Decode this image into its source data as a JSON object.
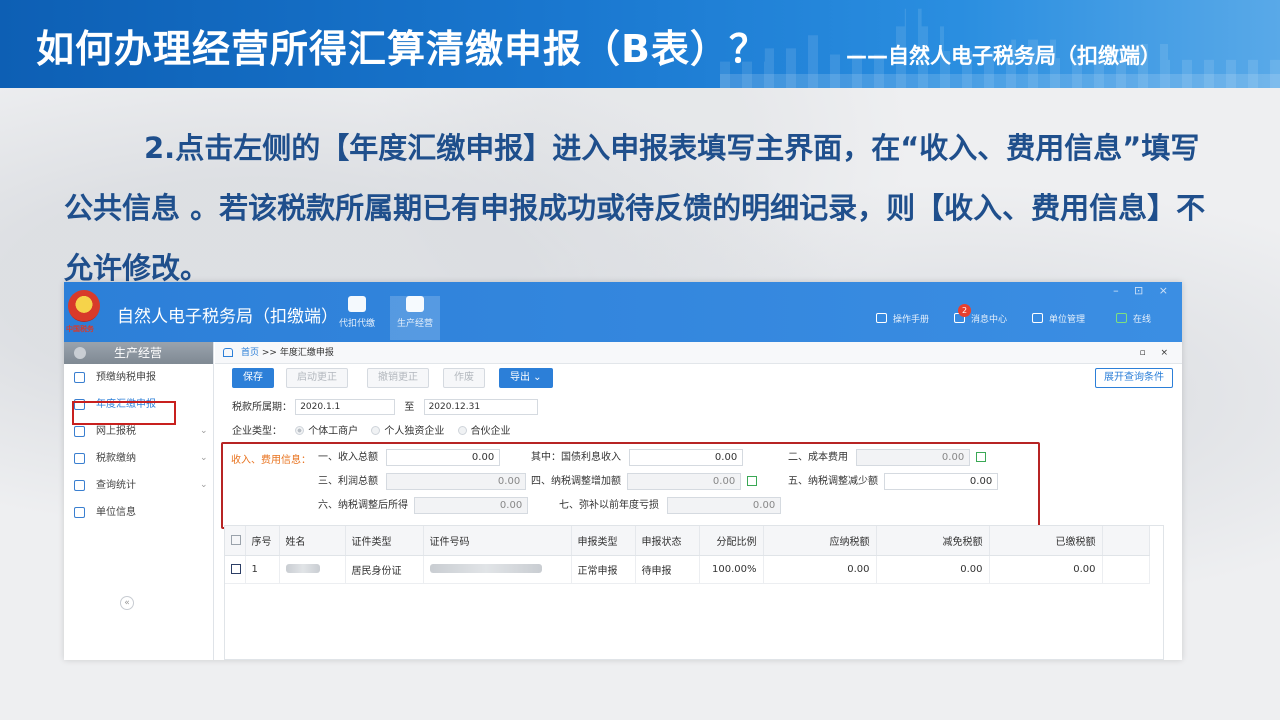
{
  "slide": {
    "title": "如何办理经营所得汇算清缴申报（B表）？",
    "subtitle": "——自然人电子税务局（扣缴端）",
    "description": "2.点击左侧的【年度汇缴申报】进入申报表填写主界面，在“收入、费用信息”填写公共信息 。若该税款所属期已有申报成功或待反馈的明细记录，则【收入、费用信息】不允许修改。"
  },
  "app": {
    "name": "自然人电子税务局（扣缴端）",
    "emblem_text": "中国税务",
    "nav": [
      {
        "label": "代扣代缴",
        "icon": "wallet-icon"
      },
      {
        "label": "生产经营",
        "icon": "coins-icon"
      }
    ],
    "header_tools": {
      "manual": "操作手册",
      "messages": "消息中心",
      "message_count": "2",
      "unit": "单位管理",
      "online": "在线"
    },
    "window_controls": "– ⊡ ×"
  },
  "sidebar": {
    "title": "生产经营",
    "items": [
      {
        "label": "预缴纳税申报",
        "chevron": ""
      },
      {
        "label": "年度汇缴申报",
        "chevron": ""
      },
      {
        "label": "网上报税",
        "chevron": "⌄"
      },
      {
        "label": "税款缴纳",
        "chevron": "⌄"
      },
      {
        "label": "查询统计",
        "chevron": "⌄"
      },
      {
        "label": "单位信息",
        "chevron": ""
      }
    ],
    "collapse": "«"
  },
  "main": {
    "breadcrumb_home": "首页",
    "breadcrumb_rest": " >> 年度汇缴申报",
    "breadcrumb_ctrls": "▫ ×",
    "toolbar": {
      "save": "保存",
      "start_correct": "启动更正",
      "cancel_correct": "撤销更正",
      "void": "作废",
      "export": "导出 ⌄",
      "expand_query": "展开查询条件"
    },
    "period_label": "税款所属期：",
    "period_start": "2020.1.1",
    "period_to": "至",
    "period_end": "2020.12.31",
    "company_type_label": "企业类型：",
    "company_types": [
      "个体工商户",
      "个人独资企业",
      "合伙企业"
    ],
    "info": {
      "section_label": "收入、费用信息：",
      "f1_label": "一、收入总额",
      "f1_value": "0.00",
      "f2_label": "其中：国债利息收入",
      "f2_value": "0.00",
      "f3_label": "二、成本费用",
      "f3_value": "0.00",
      "f4_label": "三、利润总额",
      "f4_value": "0.00",
      "f5_label": "四、纳税调整增加额",
      "f5_value": "0.00",
      "f6_label": "五、纳税调整减少额",
      "f6_value": "0.00",
      "f7_label": "六、纳税调整后所得",
      "f7_value": "0.00",
      "f8_label": "七、弥补以前年度亏损",
      "f8_value": "0.00"
    },
    "table": {
      "headers": [
        "序号",
        "姓名",
        "证件类型",
        "证件号码",
        "申报类型",
        "申报状态",
        "分配比例",
        "应纳税额",
        "减免税额",
        "已缴税额"
      ],
      "rows": [
        [
          "1",
          "",
          "居民身份证",
          "",
          "正常申报",
          "待申报",
          "100.00%",
          "0.00",
          "0.00",
          "0.00"
        ]
      ]
    }
  }
}
